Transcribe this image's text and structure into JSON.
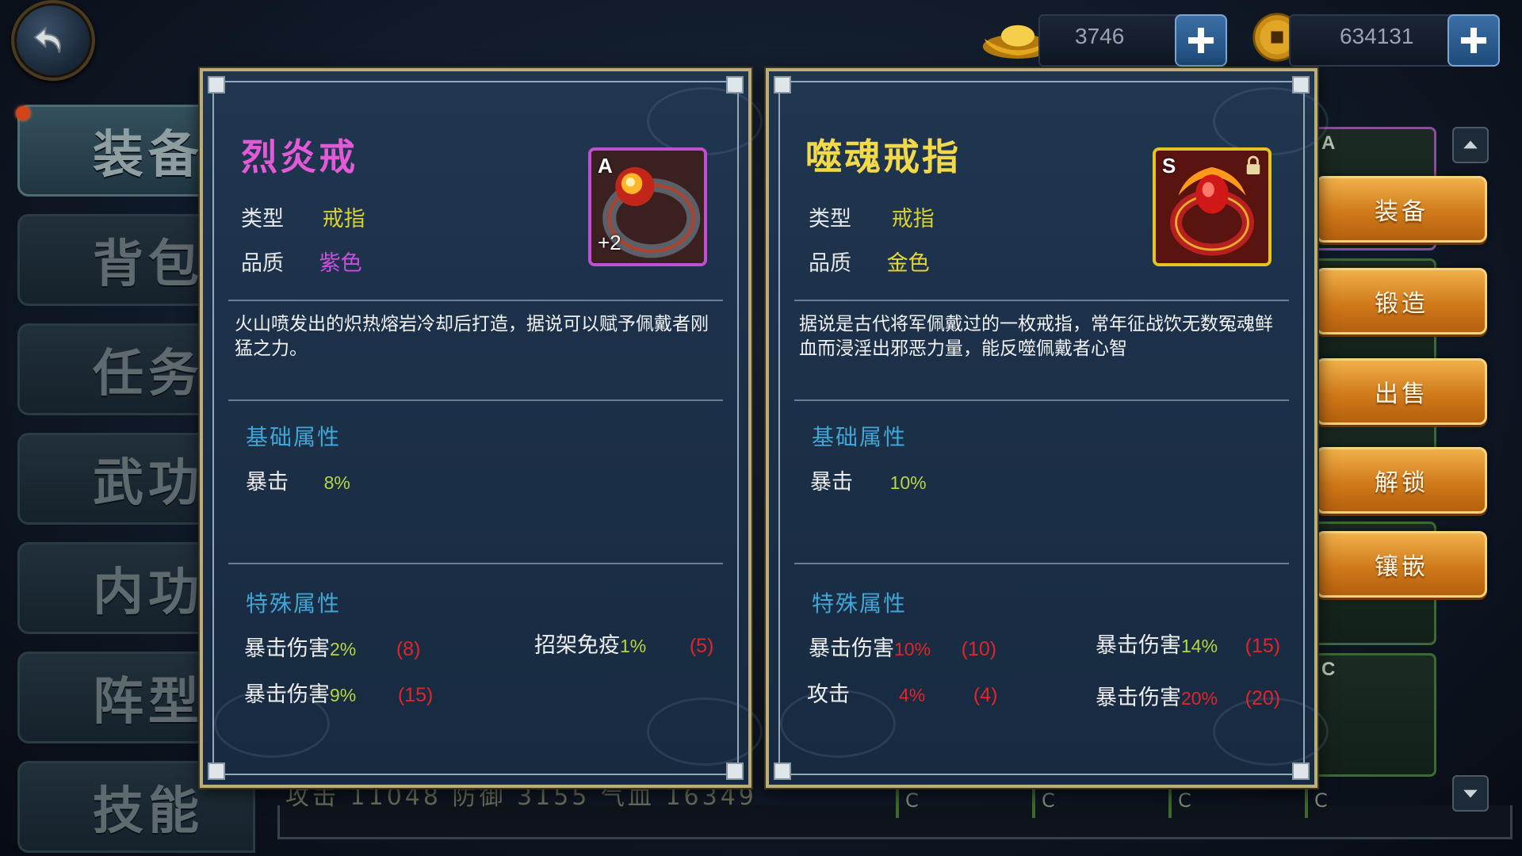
{
  "topbar": {
    "back_icon": "back-arrow-icon",
    "ingot_value": "3746",
    "coin_value": "634131",
    "ingot_icon": "gold-ingot-icon",
    "coin_icon": "copper-coin-icon"
  },
  "nav": {
    "items": [
      {
        "label": "装备",
        "active": true
      },
      {
        "label": "背包",
        "active": false
      },
      {
        "label": "任务",
        "active": false
      },
      {
        "label": "武功",
        "active": false
      },
      {
        "label": "内功",
        "active": false
      },
      {
        "label": "阵型",
        "active": false
      },
      {
        "label": "技能",
        "active": false
      }
    ]
  },
  "background": {
    "stats_text": "攻击 11048 防御 3155 气血 16349",
    "slot_grades": [
      "C",
      "C",
      "C",
      "C"
    ]
  },
  "card_left": {
    "name": "烈炎戒",
    "name_color": "#e25ad8",
    "type_label": "类型",
    "type_value": "戒指",
    "quality_label": "品质",
    "quality_value": "紫色",
    "quality_color": "#c94fe0",
    "icon_grade": "A",
    "icon_plus": "+2",
    "icon_name": "flame-ring-icon",
    "description": "火山喷发出的炽热熔岩冷却后打造，据说可以赋予佩戴者刚猛之力。",
    "base_title": "基础属性",
    "base_stats": [
      {
        "name": "暴击",
        "value": "8%"
      }
    ],
    "special_title": "特殊属性",
    "special_stats": [
      {
        "name": "暴击伤害",
        "pct": "2%",
        "num": "(8)"
      },
      {
        "name": "招架免疫",
        "pct": "1%",
        "num": "(5)"
      },
      {
        "name": "暴击伤害",
        "pct": "9%",
        "num": "(15)"
      }
    ]
  },
  "card_right": {
    "name": "噬魂戒指",
    "name_color": "#f2d94a",
    "type_label": "类型",
    "type_value": "戒指",
    "quality_label": "品质",
    "quality_value": "金色",
    "quality_color": "#e8d53a",
    "icon_grade": "S",
    "icon_name": "soul-devouring-ring-icon",
    "lock_icon": "lock-icon",
    "description": "据说是古代将军佩戴过的一枚戒指，常年征战饮无数冤魂鲜血而浸淫出邪恶力量，能反噬佩戴者心智",
    "base_title": "基础属性",
    "base_stats": [
      {
        "name": "暴击",
        "value": "10%"
      }
    ],
    "special_title": "特殊属性",
    "special_stats": [
      {
        "name": "暴击伤害",
        "pct": "10%",
        "num": "(10)"
      },
      {
        "name": "暴击伤害",
        "pct": "14%",
        "num": "(15)"
      },
      {
        "name": "攻击",
        "pct": "4%",
        "num": "(4)"
      },
      {
        "name": "暴击伤害",
        "pct": "20%",
        "num": "(20)"
      }
    ]
  },
  "actions": [
    "装备",
    "锻造",
    "出售",
    "解锁",
    "镶嵌"
  ],
  "inventory": {
    "grades": [
      "A",
      "",
      "",
      "",
      "C",
      "C"
    ]
  }
}
